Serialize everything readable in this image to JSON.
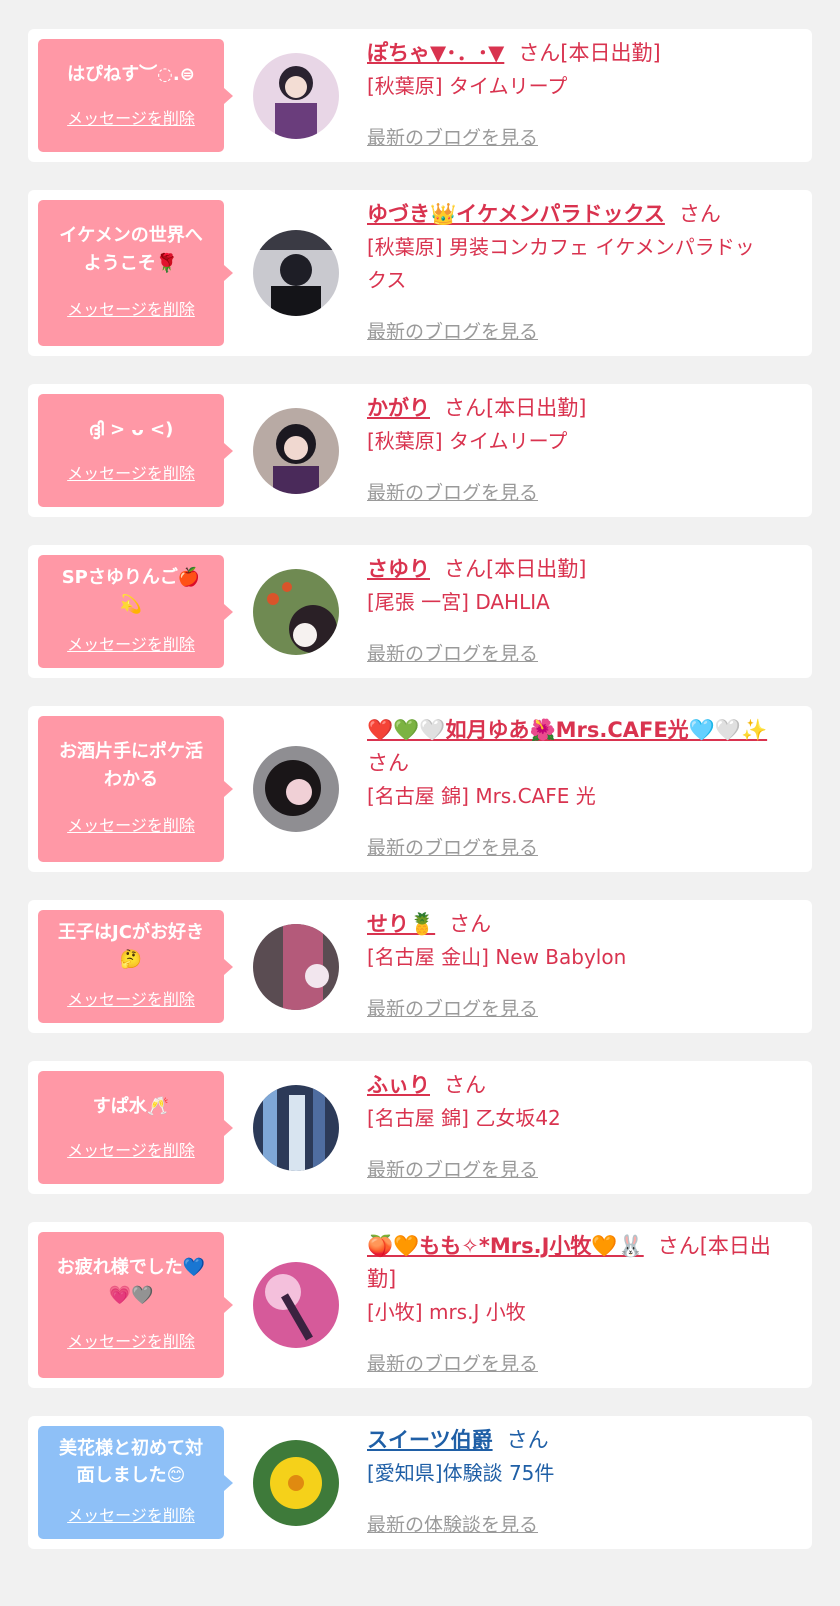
{
  "cards": [
    {
      "message": "はぴねす︶◌.⊜",
      "delete_label": "メッセージを削除",
      "name": "ぽちゃ▼･．･▼",
      "honorific": "さん[本日出勤]",
      "honorific_cont": "",
      "shop": "[秋葉原] タイムリープ",
      "shop_cont": "",
      "more_label": "最新のブログを見る"
    },
    {
      "message": "イケメンの世界へ",
      "message_2": "ようこそ🌹",
      "delete_label": "メッセージを削除",
      "name": "ゆづき👑イケメンパラドックス",
      "honorific": "さん",
      "honorific_cont": "",
      "shop": "[秋葉原] 男装コンカフェ イケメンパラドッ",
      "shop_cont": "クス",
      "more_label": "最新のブログを見る"
    },
    {
      "message": "ദ്ദി > ᴗ <)",
      "delete_label": "メッセージを削除",
      "name": "かがり",
      "honorific": "さん[本日出勤]",
      "honorific_cont": "",
      "shop": "[秋葉原] タイムリープ",
      "shop_cont": "",
      "more_label": "最新のブログを見る"
    },
    {
      "message": "SPさゆりんご🍎",
      "message_2": "💫",
      "delete_label": "メッセージを削除",
      "name": "さゆり",
      "honorific": "さん[本日出勤]",
      "honorific_cont": "",
      "shop": "[尾張 一宮] DAHLIA",
      "shop_cont": "",
      "more_label": "最新のブログを見る"
    },
    {
      "message": "お酒片手にポケ活",
      "message_2": "わかる",
      "delete_label": "メッセージを削除",
      "name": "❤️💚🤍如月ゆあ🌺Mrs.CAFE光🩵🤍✨",
      "honorific": "さん",
      "honorific_cont": "",
      "shop": "[名古屋 錦] Mrs.CAFE 光",
      "shop_cont": "",
      "more_label": "最新のブログを見る"
    },
    {
      "message": "王子はJCがお好き",
      "message_2": "🤔",
      "delete_label": "メッセージを削除",
      "name": "せり🍍",
      "honorific": "さん",
      "honorific_cont": "",
      "shop": "[名古屋 金山] New Babylon",
      "shop_cont": "",
      "more_label": "最新のブログを見る"
    },
    {
      "message": "すぱ水🥂",
      "delete_label": "メッセージを削除",
      "name": "ふぃり",
      "honorific": "さん",
      "honorific_cont": "",
      "shop": "[名古屋 錦] 乙女坂42",
      "shop_cont": "",
      "more_label": "最新のブログを見る"
    },
    {
      "message": "お疲れ様でした💙",
      "message_2": "💗🩶",
      "delete_label": "メッセージを削除",
      "name": "🍑🧡もも✧*Mrs.J小牧🧡🐰",
      "honorific": "さん[本日出",
      "honorific_cont": "勤]",
      "shop": "[小牧] mrs.J 小牧",
      "shop_cont": "",
      "more_label": "最新のブログを見る"
    },
    {
      "message": "美花様と初めて対",
      "message_2": "面しました😊",
      "delete_label": "メッセージを削除",
      "name": "スイーツ伯爵",
      "honorific": "さん",
      "honorific_cont": "",
      "shop": "[愛知県]体験談 75件",
      "shop_cont": "",
      "more_label": "最新の体験談を見る"
    }
  ],
  "colors": {
    "page_bg": "#f1f1f1",
    "bubble_pink": "#ff98a6",
    "bubble_blue": "#8ec0f7",
    "cast_text": "#d9334f",
    "user_text": "#1f5fa6",
    "link_gray": "#9a9a9a"
  },
  "avatar_icons": [
    "cast-photo",
    "cast-photo",
    "cast-photo",
    "cast-photo",
    "cast-photo",
    "cast-photo",
    "cast-photo",
    "cast-photo",
    "flower-photo"
  ]
}
